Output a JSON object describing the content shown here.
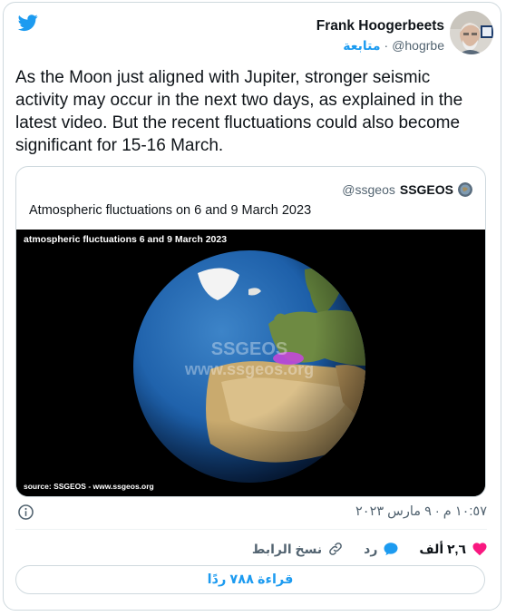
{
  "author": {
    "name": "Frank Hoogerbeets",
    "handle": "@hogrbe",
    "follow_label": "متابعة",
    "separator": "·"
  },
  "tweet": {
    "text": "As the Moon just aligned with Jupiter, stronger seismic activity may occur in the next two days, as explained in the latest video. But the recent fluctuations could also become significant for 15-16 March."
  },
  "quoted": {
    "handle": "@ssgeos",
    "name": "SSGEOS",
    "text": "Atmospheric fluctuations on 6 and 9 March 2023",
    "image": {
      "caption": "atmospheric fluctuations 6 and 9 March 2023",
      "watermark": "SSGEOS",
      "watermark_url": "www.ssgeos.org",
      "source": "source: SSGEOS - www.ssgeos.org"
    }
  },
  "meta": {
    "timestamp": "١٠:٥٧ م · ٩ مارس ٢٠٢٣"
  },
  "actions": {
    "like_count": "٢,٦ ألف",
    "reply_label": "رد",
    "copy_link_label": "نسخ الرابط"
  },
  "read_replies_label": "قراءة ٧٨٨ ردًا",
  "colors": {
    "accent": "#1d9bf0",
    "like": "#f91880",
    "border": "#cfd9de",
    "secondary_text": "#536471"
  }
}
